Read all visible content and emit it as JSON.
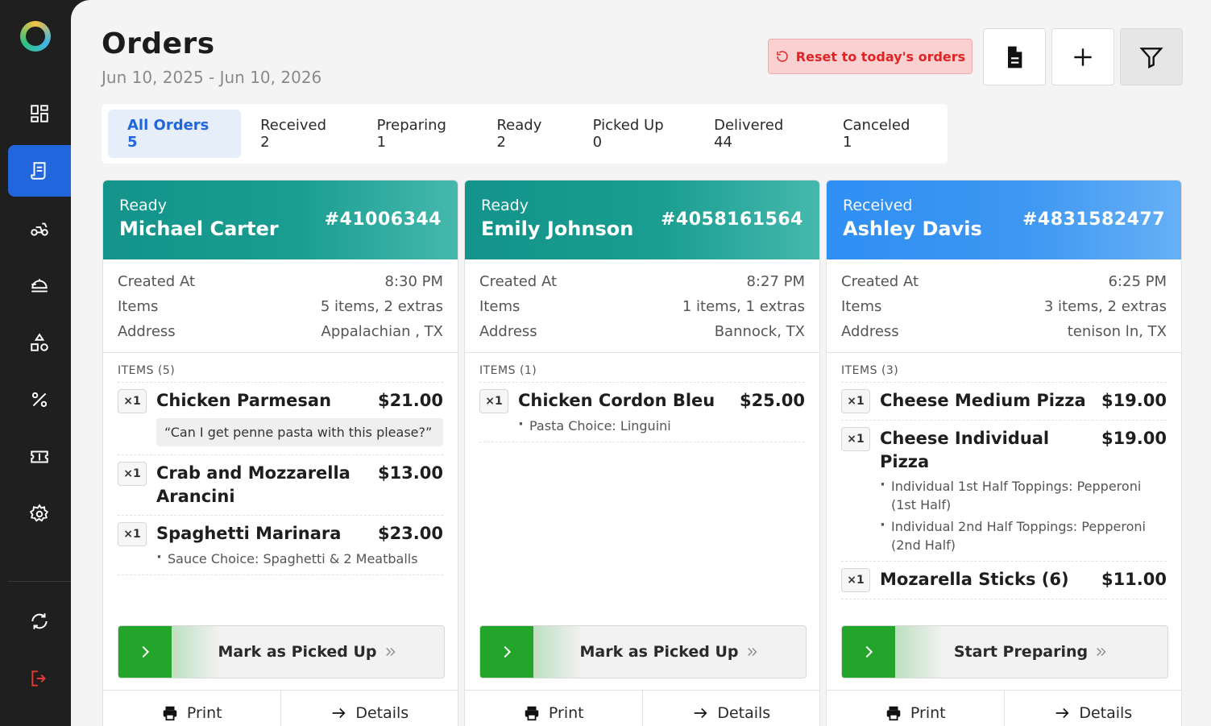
{
  "page": {
    "title": "Orders",
    "date_range": "Jun 10, 2025 - Jun 10, 2026"
  },
  "toolbar": {
    "reset_label": "Reset to today's orders"
  },
  "tabs": [
    {
      "label": "All Orders 5"
    },
    {
      "label": "Received 2"
    },
    {
      "label": "Preparing 1"
    },
    {
      "label": "Ready 2"
    },
    {
      "label": "Picked Up 0"
    },
    {
      "label": "Delivered 44"
    },
    {
      "label": "Canceled 1"
    }
  ],
  "labels": {
    "created_at": "Created At",
    "items": "Items",
    "address": "Address",
    "print": "Print",
    "details": "Details"
  },
  "orders": [
    {
      "status": "Ready",
      "customer": "Michael Carter",
      "number": "#41006344",
      "created_at": "8:30 PM",
      "items_summary": "5 items, 2 extras",
      "address": "Appalachian , TX",
      "items_heading": "ITEMS  (5)",
      "action_label": "Mark as Picked Up",
      "items": [
        {
          "qty": "×1",
          "name": "Chicken Parmesan",
          "price": "$21.00",
          "note": "“Can I get penne pasta with this please?”"
        },
        {
          "qty": "×1",
          "name": "Crab and Mozzarella Arancini",
          "price": "$13.00"
        },
        {
          "qty": "×1",
          "name": "Spaghetti Marinara",
          "price": "$23.00",
          "extras": [
            "Sauce Choice: Spaghetti & 2 Meatballs"
          ]
        }
      ]
    },
    {
      "status": "Ready",
      "customer": "Emily Johnson",
      "number": "#4058161564",
      "created_at": "8:27 PM",
      "items_summary": "1 items, 1 extras",
      "address": "Bannock, TX",
      "items_heading": "ITEMS  (1)",
      "action_label": "Mark as Picked Up",
      "items": [
        {
          "qty": "×1",
          "name": "Chicken Cordon Bleu",
          "price": "$25.00",
          "extras": [
            "Pasta Choice: Linguini"
          ]
        }
      ]
    },
    {
      "status": "Received",
      "customer": "Ashley Davis",
      "number": "#4831582477",
      "created_at": "6:25 PM",
      "items_summary": "3 items, 2 extras",
      "address": "tenison ln, TX",
      "items_heading": "ITEMS  (3)",
      "action_label": "Start Preparing",
      "items": [
        {
          "qty": "×1",
          "name": "Cheese Medium Pizza",
          "price": "$19.00"
        },
        {
          "qty": "×1",
          "name": "Cheese Individual Pizza",
          "price": "$19.00",
          "extras": [
            "Individual 1st Half Toppings: Pepperoni (1st Half)",
            "Individual 2nd Half Toppings: Pepperoni (2nd Half)"
          ]
        },
        {
          "qty": "×1",
          "name": "Mozarella Sticks (6)",
          "price": "$11.00"
        }
      ]
    }
  ],
  "colors": {
    "sidebar_bg": "#1f1f1f",
    "accent_blue": "#2166dc",
    "ready_header": "#13938a",
    "received_header": "#2f8ff3",
    "action_green": "#22a52a",
    "reset_red": "#e02424"
  },
  "icons": {
    "nav": [
      "dashboard-icon",
      "orders-icon",
      "delivery-icon",
      "menu-icon",
      "categories-icon",
      "discount-icon",
      "coupon-icon",
      "settings-icon",
      "sync-icon",
      "logout-icon"
    ],
    "toolbar": [
      "reset-icon",
      "document-icon",
      "plus-icon",
      "filter-icon"
    ]
  }
}
